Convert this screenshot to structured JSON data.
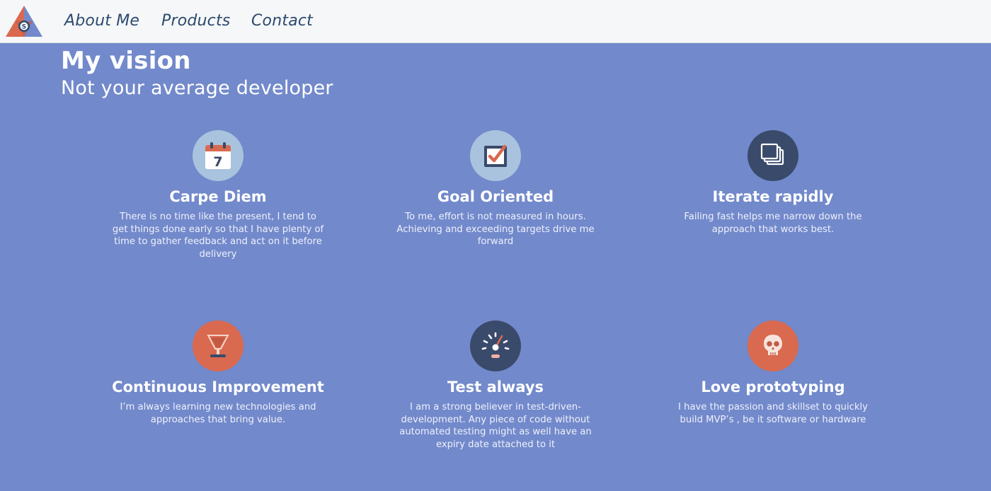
{
  "nav": {
    "items": [
      {
        "label": "About Me"
      },
      {
        "label": "Products"
      },
      {
        "label": "Contact"
      }
    ]
  },
  "hero": {
    "title": "My vision",
    "subtitle": "Not your average developer"
  },
  "features": [
    {
      "icon": "calendar-icon",
      "title": "Carpe Diem",
      "icon_number": "7",
      "description": "There is no time like the present, I tend to get things done early so that I have plenty of time to gather feedback and act on it before delivery"
    },
    {
      "icon": "checkbox-icon",
      "title": "Goal Oriented",
      "description": "To me, effort is not measured in hours. Achieving and exceeding targets drive me forward"
    },
    {
      "icon": "stacked-windows-icon",
      "title": "Iterate rapidly",
      "description": "Failing fast helps me narrow down the approach that works best."
    },
    {
      "icon": "funnel-icon",
      "title": "Continuous Improvement",
      "description": "I’m always learning new technologies and approaches that bring value."
    },
    {
      "icon": "speedometer-icon",
      "title": "Test always",
      "description": "I am a strong believer in test-driven-development. Any piece of code without automated testing might as well have an expiry date attached to it"
    },
    {
      "icon": "skull-icon",
      "title": "Love prototyping",
      "description": "I have the passion and skillset to quickly build MVP’s , be it software or hardware"
    }
  ],
  "colors": {
    "background": "#7289cb",
    "navbar": "#f6f7f8",
    "nav_text": "#2b4a6f",
    "accent_orange": "#d9694f",
    "icon_dark": "#3a4a6b",
    "icon_light": "#a9c3de"
  }
}
